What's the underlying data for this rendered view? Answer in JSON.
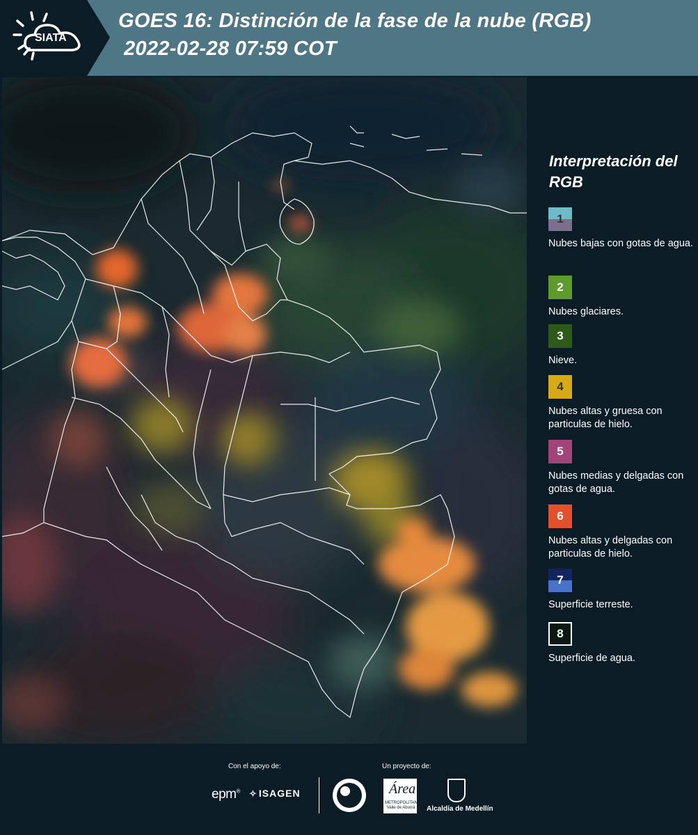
{
  "header": {
    "logo_text": "SIATA",
    "title_line1": "GOES 16: Distinción de la fase de la nube (RGB)",
    "title_line2": "2022-02-28 07:59 COT"
  },
  "legend": {
    "title": "Interpretación del RGB",
    "items": [
      {
        "number": "1",
        "label": "Nubes bajas con gotas de agua.",
        "color_top": "#6fbac7",
        "color_bottom": "#7c6f8e",
        "text_color": "#333333"
      },
      {
        "number": "2",
        "label": "Nubes glaciares.",
        "color_top": "#5e9a2c",
        "color_bottom": "#5e9a2c",
        "text_color": "#ffffff"
      },
      {
        "number": "3",
        "label": "Nieve.",
        "color_top": "#2d5a1b",
        "color_bottom": "#2d5a1b",
        "text_color": "#ffffff"
      },
      {
        "number": "4",
        "label": "Nubes altas y gruesa con particulas de hielo.",
        "color_top": "#d8a916",
        "color_bottom": "#d8a916",
        "text_color": "#333333"
      },
      {
        "number": "5",
        "label": "Nubes medias y delgadas con gotas de agua.",
        "color_top": "#a0447a",
        "color_bottom": "#a0447a",
        "text_color": "#ffffff"
      },
      {
        "number": "6",
        "label": "Nubes altas y delgadas con particulas de hielo.",
        "color_top": "#e2502d",
        "color_bottom": "#e2502d",
        "text_color": "#ffffff"
      },
      {
        "number": "7",
        "label": "Superficie terreste.",
        "color_top": "#13245e",
        "color_bottom": "#4a72c7",
        "text_color": "#ffffff"
      },
      {
        "number": "8",
        "label": "Superficie de agua.",
        "color_top": "#0a1a10",
        "color_bottom": "#0a1a10",
        "text_color": "#ffffff"
      }
    ]
  },
  "footer": {
    "support_label": "Con el apoyo de:",
    "project_label": "Un proyecto de:",
    "epm": "epm",
    "epm_mark": "®",
    "isagen": "ISAGEN",
    "area_logo_big": "Área",
    "area_logo_small": "METROPOLITANA Valle de Aburrá",
    "alcaldia": "Alcaldía de Medellín"
  }
}
